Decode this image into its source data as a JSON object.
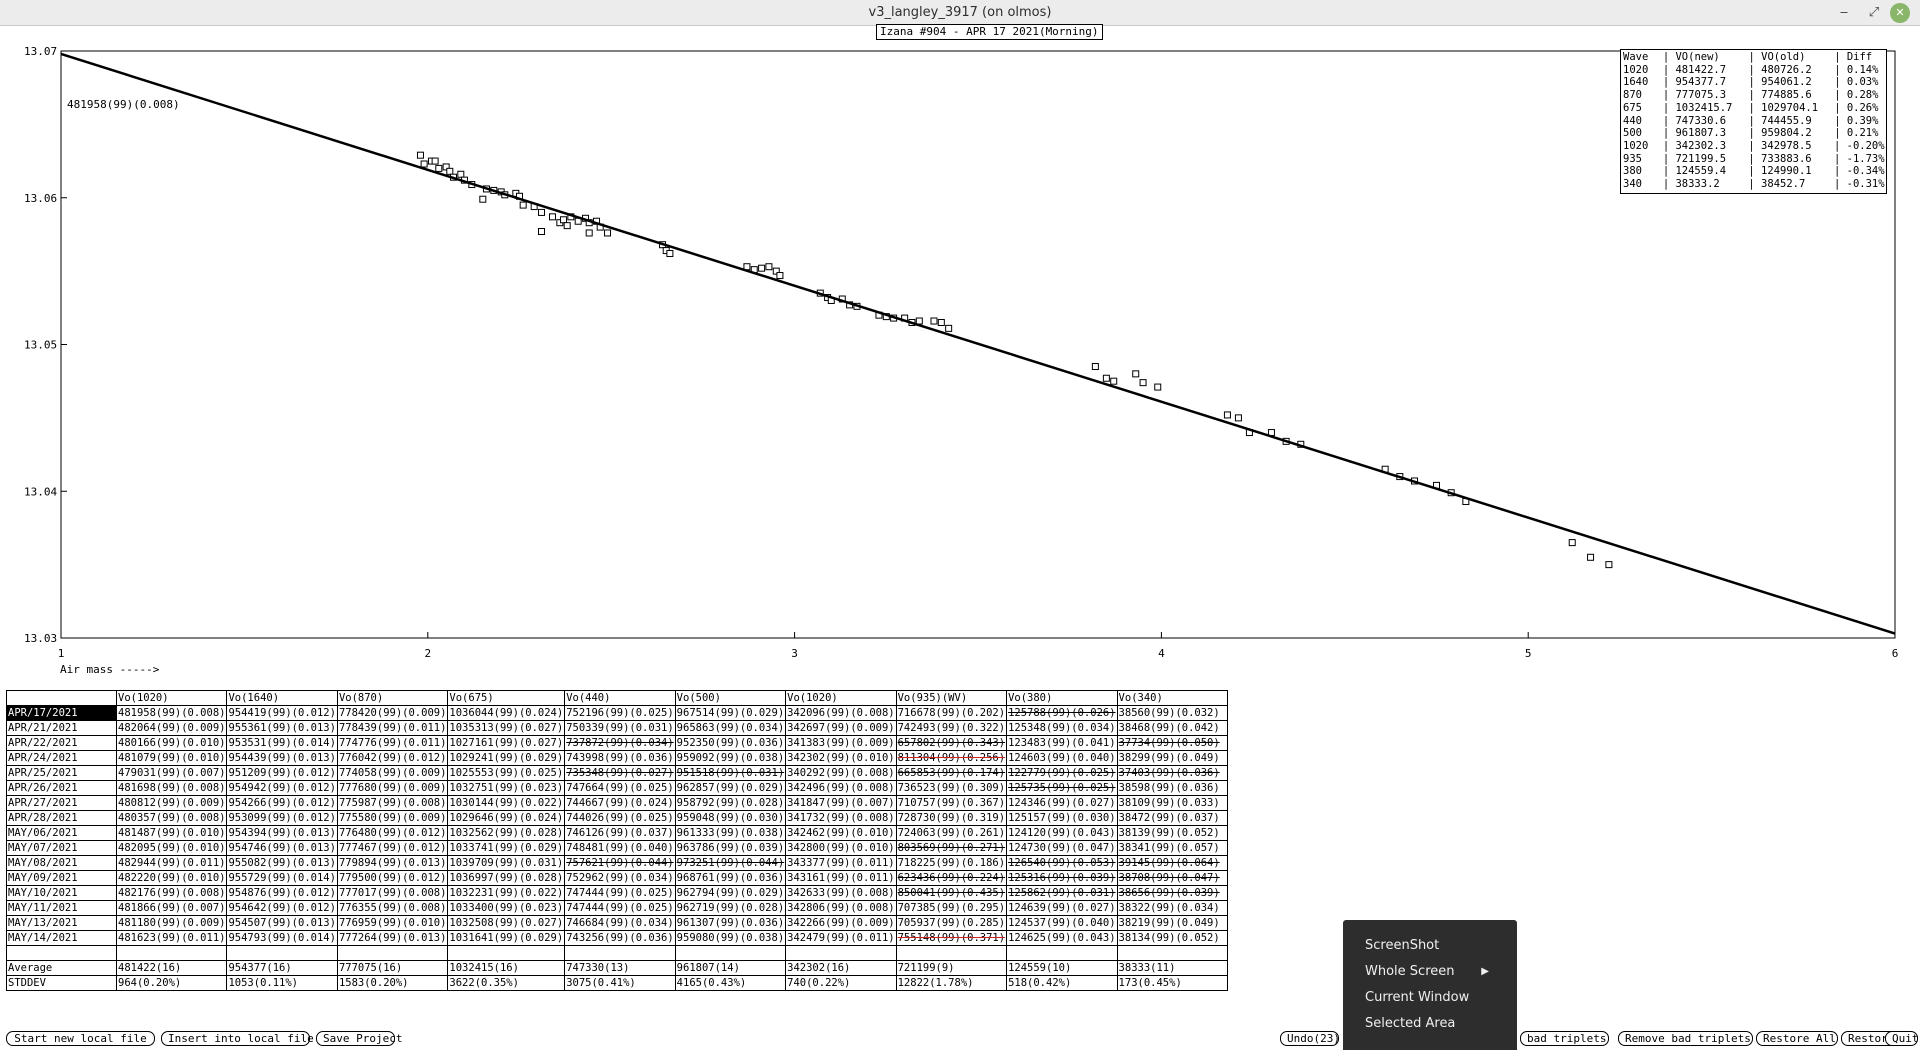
{
  "window": {
    "title": "v3_langley_3917 (on olmos)",
    "minimize": "‒",
    "maximize": "⤢",
    "close": "✕"
  },
  "plot": {
    "title": "Izana #904 - APR 17 2021(Morning)",
    "annotation": "481958(99)(0.008)",
    "xlabel": "Air mass ----->"
  },
  "chart_data": {
    "type": "scatter",
    "title": "Izana #904 - APR 17 2021(Morning)",
    "xlabel": "Air mass ----->",
    "ylabel": "",
    "xlim": [
      1,
      6
    ],
    "ylim": [
      13.03,
      13.07
    ],
    "x_ticks": [
      "1",
      "2",
      "3",
      "4",
      "5",
      "6"
    ],
    "y_ticks": [
      "13.03",
      "13.04",
      "13.05",
      "13.06",
      "13.07"
    ],
    "fit_line": {
      "x": [
        1,
        6
      ],
      "y": [
        13.0698,
        13.0303
      ]
    },
    "points": [
      [
        1.98,
        13.0629
      ],
      [
        1.99,
        13.0623
      ],
      [
        2.01,
        13.0625
      ],
      [
        2.02,
        13.0625
      ],
      [
        2.03,
        13.062
      ],
      [
        2.05,
        13.0621
      ],
      [
        2.06,
        13.0618
      ],
      [
        2.07,
        13.0614
      ],
      [
        2.09,
        13.0616
      ],
      [
        2.1,
        13.0612
      ],
      [
        2.12,
        13.0609
      ],
      [
        2.16,
        13.0606
      ],
      [
        2.18,
        13.0605
      ],
      [
        2.2,
        13.0604
      ],
      [
        2.15,
        13.0599
      ],
      [
        2.21,
        13.0602
      ],
      [
        2.24,
        13.0603
      ],
      [
        2.25,
        13.0601
      ],
      [
        2.26,
        13.0595
      ],
      [
        2.29,
        13.0594
      ],
      [
        2.31,
        13.059
      ],
      [
        2.34,
        13.0587
      ],
      [
        2.36,
        13.0583
      ],
      [
        2.37,
        13.0585
      ],
      [
        2.38,
        13.0581
      ],
      [
        2.39,
        13.0587
      ],
      [
        2.41,
        13.0584
      ],
      [
        2.43,
        13.0586
      ],
      [
        2.44,
        13.0583
      ],
      [
        2.46,
        13.0584
      ],
      [
        2.47,
        13.058
      ],
      [
        2.31,
        13.0577
      ],
      [
        2.44,
        13.0576
      ],
      [
        2.49,
        13.0576
      ],
      [
        2.64,
        13.0568
      ],
      [
        2.65,
        13.0564
      ],
      [
        2.66,
        13.0562
      ],
      [
        2.87,
        13.0553
      ],
      [
        2.89,
        13.0551
      ],
      [
        2.91,
        13.0552
      ],
      [
        2.93,
        13.0553
      ],
      [
        2.95,
        13.055
      ],
      [
        2.96,
        13.0547
      ],
      [
        3.07,
        13.0535
      ],
      [
        3.09,
        13.0532
      ],
      [
        3.1,
        13.053
      ],
      [
        3.13,
        13.0531
      ],
      [
        3.15,
        13.0527
      ],
      [
        3.17,
        13.0526
      ],
      [
        3.23,
        13.052
      ],
      [
        3.25,
        13.0519
      ],
      [
        3.27,
        13.0518
      ],
      [
        3.3,
        13.0518
      ],
      [
        3.32,
        13.0515
      ],
      [
        3.34,
        13.0516
      ],
      [
        3.38,
        13.0516
      ],
      [
        3.4,
        13.0515
      ],
      [
        3.42,
        13.0511
      ],
      [
        3.82,
        13.0485
      ],
      [
        3.85,
        13.0477
      ],
      [
        3.87,
        13.0475
      ],
      [
        3.93,
        13.048
      ],
      [
        3.95,
        13.0474
      ],
      [
        3.99,
        13.0471
      ],
      [
        4.18,
        13.0452
      ],
      [
        4.21,
        13.045
      ],
      [
        4.24,
        13.044
      ],
      [
        4.3,
        13.044
      ],
      [
        4.34,
        13.0434
      ],
      [
        4.38,
        13.0432
      ],
      [
        4.61,
        13.0415
      ],
      [
        4.65,
        13.041
      ],
      [
        4.69,
        13.0407
      ],
      [
        4.75,
        13.0404
      ],
      [
        4.79,
        13.0399
      ],
      [
        4.83,
        13.0393
      ],
      [
        5.12,
        13.0365
      ],
      [
        5.17,
        13.0355
      ],
      [
        5.22,
        13.035
      ]
    ]
  },
  "wave_table": {
    "header": [
      "Wave",
      "| VO(new)",
      "| VO(old)",
      "| Diff"
    ],
    "rows": [
      [
        "1020",
        "| 481422.7",
        "| 480726.2",
        "| 0.14%"
      ],
      [
        "1640",
        "| 954377.7",
        "| 954061.2",
        "| 0.03%"
      ],
      [
        "870",
        "| 777075.3",
        "| 774885.6",
        "| 0.28%"
      ],
      [
        "675",
        "| 1032415.7",
        "| 1029704.1",
        "| 0.26%"
      ],
      [
        "440",
        "| 747330.6",
        "| 744455.9",
        "| 0.39%"
      ],
      [
        "500",
        "| 961807.3",
        "| 959804.2",
        "| 0.21%"
      ],
      [
        "1020",
        "| 342302.3",
        "| 342978.5",
        "| -0.20%"
      ],
      [
        "935",
        "| 721199.5",
        "| 733883.6",
        "| -1.73%"
      ],
      [
        "380",
        "| 124559.4",
        "| 124990.1",
        "| -0.34%"
      ],
      [
        "340",
        "| 38333.2",
        "| 38452.7",
        "| -0.31%"
      ]
    ]
  },
  "data_table": {
    "headers": [
      "",
      "Vo(1020)",
      "Vo(1640)",
      "Vo(870)",
      "Vo(675)",
      "Vo(440)",
      "Vo(500)",
      "Vo(1020)",
      "Vo(935)(WV)",
      "Vo(380)",
      "Vo(340)"
    ],
    "rows": [
      [
        "APR/17/2021",
        "481958(99)(0.008)",
        "954419(99)(0.012)",
        "778420(99)(0.009)",
        "1036044(99)(0.024)",
        "752196(99)(0.025)",
        "967514(99)(0.029)",
        "342096(99)(0.008)",
        "716678(99)(0.202)",
        "125788(99)(0.026)",
        "38560(99)(0.032)"
      ],
      [
        "APR/21/2021",
        "482064(99)(0.009)",
        "955361(99)(0.013)",
        "778439(99)(0.011)",
        "1035313(99)(0.027)",
        "750339(99)(0.031)",
        "965863(99)(0.034)",
        "342697(99)(0.009)",
        "742493(99)(0.322)",
        "125348(99)(0.034)",
        "38468(99)(0.042)"
      ],
      [
        "APR/22/2021",
        "480166(99)(0.010)",
        "953531(99)(0.014)",
        "774776(99)(0.011)",
        "1027161(99)(0.027)",
        "737872(99)(0.034)",
        "952350(99)(0.036)",
        "341383(99)(0.009)",
        "657802(99)(0.343)",
        "123483(99)(0.041)",
        "37734(99)(0.050)"
      ],
      [
        "APR/24/2021",
        "481079(99)(0.010)",
        "954439(99)(0.013)",
        "776042(99)(0.012)",
        "1029241(99)(0.029)",
        "743998(99)(0.036)",
        "959092(99)(0.038)",
        "342302(99)(0.010)",
        "811304(99)(0.256)",
        "124603(99)(0.040)",
        "38299(99)(0.049)"
      ],
      [
        "APR/25/2021",
        "479031(99)(0.007)",
        "951209(99)(0.012)",
        "774058(99)(0.009)",
        "1025553(99)(0.025)",
        "735348(99)(0.027)",
        "951518(99)(0.031)",
        "340292(99)(0.008)",
        "665853(99)(0.174)",
        "122779(99)(0.025)",
        "37403(99)(0.036)"
      ],
      [
        "APR/26/2021",
        "481698(99)(0.008)",
        "954942(99)(0.012)",
        "777680(99)(0.009)",
        "1032751(99)(0.023)",
        "747664(99)(0.025)",
        "962857(99)(0.029)",
        "342496(99)(0.008)",
        "736523(99)(0.309)",
        "125735(99)(0.025)",
        "38598(99)(0.036)"
      ],
      [
        "APR/27/2021",
        "480812(99)(0.009)",
        "954266(99)(0.012)",
        "775987(99)(0.008)",
        "1030144(99)(0.022)",
        "744667(99)(0.024)",
        "958792(99)(0.028)",
        "341847(99)(0.007)",
        "710757(99)(0.367)",
        "124346(99)(0.027)",
        "38109(99)(0.033)"
      ],
      [
        "APR/28/2021",
        "480357(99)(0.008)",
        "953099(99)(0.012)",
        "775580(99)(0.009)",
        "1029646(99)(0.024)",
        "744026(99)(0.025)",
        "959048(99)(0.030)",
        "341732(99)(0.008)",
        "728730(99)(0.319)",
        "125157(99)(0.030)",
        "38472(99)(0.037)"
      ],
      [
        "MAY/06/2021",
        "481487(99)(0.010)",
        "954394(99)(0.013)",
        "776480(99)(0.012)",
        "1032562(99)(0.028)",
        "746126(99)(0.037)",
        "961333(99)(0.038)",
        "342462(99)(0.010)",
        "724063(99)(0.261)",
        "124120(99)(0.043)",
        "38139(99)(0.052)"
      ],
      [
        "MAY/07/2021",
        "482095(99)(0.010)",
        "954746(99)(0.013)",
        "777467(99)(0.012)",
        "1033741(99)(0.029)",
        "748481(99)(0.040)",
        "963786(99)(0.039)",
        "342800(99)(0.010)",
        "803569(99)(0.271)",
        "124730(99)(0.047)",
        "38341(99)(0.057)"
      ],
      [
        "MAY/08/2021",
        "482944(99)(0.011)",
        "955082(99)(0.013)",
        "779894(99)(0.013)",
        "1039709(99)(0.031)",
        "757621(99)(0.044)",
        "973251(99)(0.044)",
        "343377(99)(0.011)",
        "718225(99)(0.186)",
        "126540(99)(0.053)",
        "39145(99)(0.064)"
      ],
      [
        "MAY/09/2021",
        "482220(99)(0.010)",
        "955729(99)(0.014)",
        "779500(99)(0.012)",
        "1036997(99)(0.028)",
        "752962(99)(0.034)",
        "968761(99)(0.036)",
        "343161(99)(0.011)",
        "623436(99)(0.224)",
        "125316(99)(0.039)",
        "38708(99)(0.047)"
      ],
      [
        "MAY/10/2021",
        "482176(99)(0.008)",
        "954876(99)(0.012)",
        "777017(99)(0.008)",
        "1032231(99)(0.022)",
        "747444(99)(0.025)",
        "962794(99)(0.029)",
        "342633(99)(0.008)",
        "850041(99)(0.435)",
        "125862(99)(0.031)",
        "38656(99)(0.039)"
      ],
      [
        "MAY/11/2021",
        "481866(99)(0.007)",
        "954642(99)(0.012)",
        "776355(99)(0.008)",
        "1033400(99)(0.023)",
        "747444(99)(0.025)",
        "962719(99)(0.028)",
        "342806(99)(0.008)",
        "707385(99)(0.295)",
        "124639(99)(0.027)",
        "38322(99)(0.034)"
      ],
      [
        "MAY/13/2021",
        "481180(99)(0.009)",
        "954507(99)(0.013)",
        "776959(99)(0.010)",
        "1032508(99)(0.027)",
        "746684(99)(0.034)",
        "961307(99)(0.036)",
        "342266(99)(0.009)",
        "705937(99)(0.285)",
        "124537(99)(0.040)",
        "38219(99)(0.049)"
      ],
      [
        "MAY/14/2021",
        "481623(99)(0.011)",
        "954793(99)(0.014)",
        "777264(99)(0.013)",
        "1031641(99)(0.029)",
        "743256(99)(0.036)",
        "959080(99)(0.038)",
        "342479(99)(0.011)",
        "755148(99)(0.371)",
        "124625(99)(0.043)",
        "38134(99)(0.052)"
      ]
    ],
    "average": [
      "Average",
      "481422(16)",
      "954377(16)",
      "777075(16)",
      "1032415(16)",
      "747330(13)",
      "961807(14)",
      "342302(16)",
      "721199(9)",
      "124559(10)",
      "38333(11)"
    ],
    "stddev": [
      "STDDEV",
      " 964(0.20%)",
      "1053(0.11%)",
      "1583(0.20%)",
      "3622(0.35%)",
      "3075(0.41%)",
      "4165(0.43%)",
      " 740(0.22%)",
      "12822(1.78%)",
      " 518(0.42%)",
      " 173(0.45%)"
    ]
  },
  "buttons": {
    "start_new_local_file": "Start new local file",
    "insert_into_local_file": "Insert into local file",
    "save_project": "Save Project",
    "undo": "Undo(23)",
    "bad_triplets": "bad triplets",
    "remove_bad_triplets": "Remove bad triplets",
    "restore_all": "Restore All",
    "restore": "Restore",
    "quit": "Quit"
  },
  "context_menu": {
    "items": [
      "ScreenShot",
      "Whole Screen",
      "Current Window",
      "Selected Area"
    ],
    "submenu_arrow": "▶"
  }
}
